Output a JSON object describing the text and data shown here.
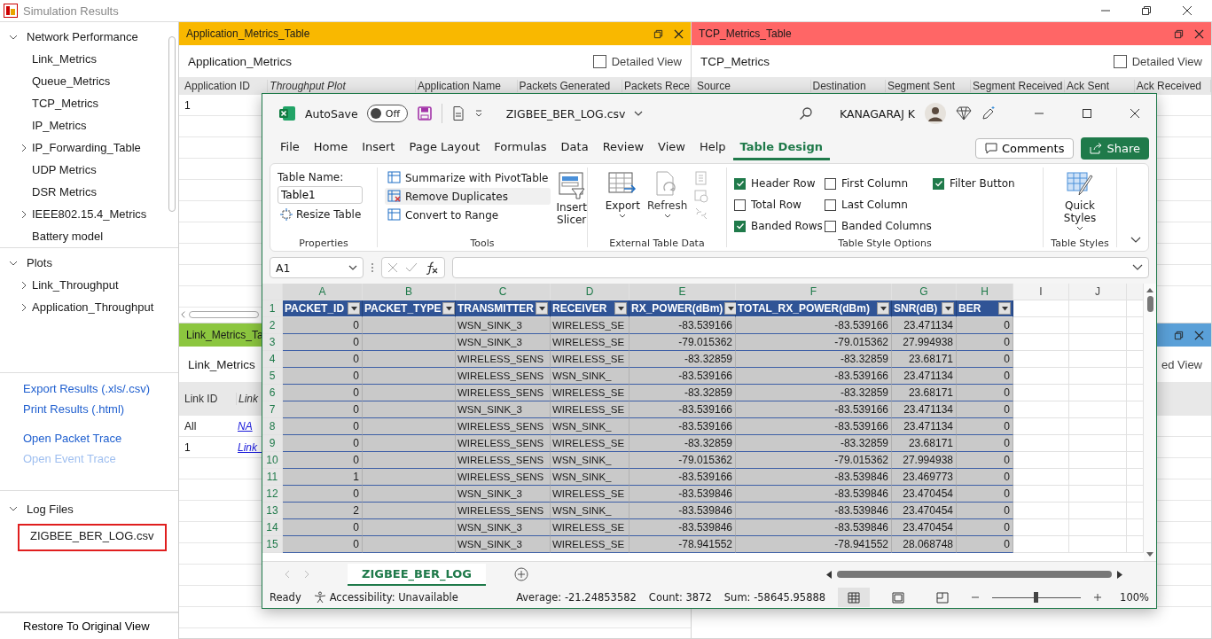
{
  "window": {
    "title": "Simulation Results"
  },
  "sidebar": {
    "tree": [
      {
        "label": "Network Performance",
        "expanded": true,
        "children": [
          {
            "label": "Link_Metrics",
            "kind": "leaf"
          },
          {
            "label": "Queue_Metrics",
            "kind": "leaf"
          },
          {
            "label": "TCP_Metrics",
            "kind": "leaf"
          },
          {
            "label": "IP_Metrics",
            "kind": "leaf"
          },
          {
            "label": "IP_Forwarding_Table",
            "kind": "branch",
            "expanded": false
          },
          {
            "label": "UDP Metrics",
            "kind": "leaf"
          },
          {
            "label": "DSR Metrics",
            "kind": "leaf"
          },
          {
            "label": "IEEE802.15.4_Metrics",
            "kind": "branch",
            "expanded": false
          },
          {
            "label": "Battery model",
            "kind": "leaf"
          }
        ]
      },
      {
        "label": "Plots",
        "expanded": true,
        "children": [
          {
            "label": "Link_Throughput",
            "kind": "branch",
            "expanded": false
          },
          {
            "label": "Application_Throughput",
            "kind": "branch",
            "expanded": false
          }
        ]
      }
    ],
    "links": [
      {
        "label": "Export Results (.xls/.csv)",
        "disabled": false
      },
      {
        "label": "Print Results (.html)",
        "disabled": false
      },
      {
        "label": "Open Packet Trace",
        "disabled": false
      },
      {
        "label": "Open Event Trace",
        "disabled": true
      }
    ],
    "log_files": {
      "label": "Log Files",
      "expanded": true,
      "files": [
        {
          "label": "ZIGBEE_BER_LOG.csv",
          "highlighted": true
        }
      ]
    },
    "restore_button": "Restore To Original View"
  },
  "panels": [
    {
      "title": "Application_Metrics_Table",
      "color": "#f9b800",
      "heading": "Application_Metrics",
      "detailed_view": {
        "label": "Detailed View",
        "checked": false
      },
      "columns": [
        {
          "label": "Application ID",
          "italic": false
        },
        {
          "label": "Throughput Plot",
          "italic": true
        },
        {
          "label": "Application Name",
          "italic": false
        },
        {
          "label": "Packets Generated",
          "italic": false
        },
        {
          "label": "Packets Rece",
          "italic": false
        }
      ],
      "rows": [
        [
          {
            "text": "1",
            "link": false
          }
        ]
      ]
    },
    {
      "title": "TCP_Metrics_Table",
      "color": "#ff6666",
      "heading": "TCP_Metrics",
      "detailed_view": {
        "label": "Detailed View",
        "checked": false
      },
      "columns": [
        {
          "label": "Source",
          "italic": false
        },
        {
          "label": "Destination",
          "italic": false
        },
        {
          "label": "Segment Sent",
          "italic": false
        },
        {
          "label": "Segment Received",
          "italic": false
        },
        {
          "label": "Ack Sent",
          "italic": false
        },
        {
          "label": "Ack Received",
          "italic": false
        }
      ]
    },
    {
      "title": "Link_Metrics_Ta",
      "color": "#8cc63f",
      "heading": "Link_Metrics",
      "columns": [
        {
          "label": "Link ID",
          "italic": false
        },
        {
          "label": "Link",
          "italic": true
        }
      ],
      "rows": [
        [
          {
            "text": "All",
            "link": false
          },
          {
            "text": "NA",
            "link": true
          }
        ],
        [
          {
            "text": "1",
            "link": false
          },
          {
            "text": "Link_",
            "link": true
          }
        ]
      ]
    },
    {
      "color": "#5aa0d8",
      "detailed_view": {
        "label": "ed View"
      }
    }
  ],
  "excel": {
    "autosave": {
      "label": "AutoSave",
      "on": false,
      "state_label": "Off"
    },
    "file_name": "ZIGBEE_BER_LOG.csv",
    "user": "KANAGARAJ K",
    "tabs": [
      {
        "label": "File",
        "selected": false
      },
      {
        "label": "Home",
        "selected": false
      },
      {
        "label": "Insert",
        "selected": false
      },
      {
        "label": "Page Layout",
        "selected": false
      },
      {
        "label": "Formulas",
        "selected": false
      },
      {
        "label": "Data",
        "selected": false
      },
      {
        "label": "Review",
        "selected": false
      },
      {
        "label": "View",
        "selected": false
      },
      {
        "label": "Help",
        "selected": false
      },
      {
        "label": "Table Design",
        "selected": true
      }
    ],
    "comments": "Comments",
    "share": "Share",
    "ribbon": {
      "properties": {
        "name_label": "Table Name:",
        "name_value": "Table1",
        "resize": "Resize Table",
        "group": "Properties"
      },
      "tools": {
        "items": [
          "Summarize with PivotTable",
          "Remove Duplicates",
          "Convert to Range"
        ],
        "slicer": "Insert Slicer",
        "group": "Tools"
      },
      "external": {
        "export": "Export",
        "refresh": "Refresh",
        "group": "External Table Data"
      },
      "style_options": {
        "options": [
          {
            "label": "Header Row",
            "checked": true
          },
          {
            "label": "Total Row",
            "checked": false
          },
          {
            "label": "Banded Rows",
            "checked": true
          },
          {
            "label": "First Column",
            "checked": false
          },
          {
            "label": "Last Column",
            "checked": false
          },
          {
            "label": "Banded Columns",
            "checked": false
          },
          {
            "label": "Filter Button",
            "checked": true
          }
        ],
        "group": "Table Style Options"
      },
      "styles": {
        "label": "Quick Styles",
        "group": "Table Styles"
      }
    },
    "name_box": "A1",
    "sheet": {
      "column_letters": [
        "A",
        "B",
        "C",
        "D",
        "E",
        "F",
        "G",
        "H",
        "I",
        "J"
      ],
      "header_row_number": "1",
      "headers": [
        "PACKET_ID",
        "PACKET_TYPE",
        "TRANSMITTER",
        "RECEIVER",
        "RX_POWER(dBm)",
        "TOTAL_RX_POWER(dBm)",
        "SNR(dB)",
        "BER"
      ],
      "rows": [
        {
          "n": "2",
          "cells": [
            "0",
            "WSN_SINK_3",
            "WIRELESS_SE",
            "-83.539166",
            "-83.539166",
            "23.471134",
            "0"
          ]
        },
        {
          "n": "3",
          "cells": [
            "0",
            "WSN_SINK_3",
            "WIRELESS_SE",
            "-79.015362",
            "-79.015362",
            "27.994938",
            "0"
          ]
        },
        {
          "n": "4",
          "cells": [
            "0",
            "WIRELESS_SENS",
            "WIRELESS_SE",
            "-83.32859",
            "-83.32859",
            "23.68171",
            "0"
          ]
        },
        {
          "n": "5",
          "cells": [
            "0",
            "WIRELESS_SENS",
            "WSN_SINK_",
            "-83.539166",
            "-83.539166",
            "23.471134",
            "0"
          ]
        },
        {
          "n": "6",
          "cells": [
            "0",
            "WIRELESS_SENS",
            "WIRELESS_SE",
            "-83.32859",
            "-83.32859",
            "23.68171",
            "0"
          ]
        },
        {
          "n": "7",
          "cells": [
            "0",
            "WSN_SINK_3",
            "WIRELESS_SE",
            "-83.539166",
            "-83.539166",
            "23.471134",
            "0"
          ]
        },
        {
          "n": "8",
          "cells": [
            "0",
            "WIRELESS_SENS",
            "WSN_SINK_",
            "-83.539166",
            "-83.539166",
            "23.471134",
            "0"
          ]
        },
        {
          "n": "9",
          "cells": [
            "0",
            "WIRELESS_SENS",
            "WIRELESS_SE",
            "-83.32859",
            "-83.32859",
            "23.68171",
            "0"
          ]
        },
        {
          "n": "10",
          "cells": [
            "0",
            "WIRELESS_SENS",
            "WSN_SINK_",
            "-79.015362",
            "-79.015362",
            "27.994938",
            "0"
          ]
        },
        {
          "n": "11",
          "cells": [
            "1",
            "WIRELESS_SENS",
            "WSN_SINK_",
            "-83.539166",
            "-83.539846",
            "23.469773",
            "0"
          ]
        },
        {
          "n": "12",
          "cells": [
            "0",
            "WSN_SINK_3",
            "WIRELESS_SE",
            "-83.539846",
            "-83.539846",
            "23.470454",
            "0"
          ]
        },
        {
          "n": "13",
          "cells": [
            "2",
            "WIRELESS_SENS",
            "WSN_SINK_",
            "-83.539846",
            "-83.539846",
            "23.470454",
            "0"
          ]
        },
        {
          "n": "14",
          "cells": [
            "0",
            "WSN_SINK_3",
            "WIRELESS_SE",
            "-83.539846",
            "-83.539846",
            "23.470454",
            "0"
          ]
        },
        {
          "n": "15",
          "cells": [
            "0",
            "WSN_SINK_3",
            "WIRELESS_SE",
            "-78.941552",
            "-78.941552",
            "28.068748",
            "0"
          ]
        }
      ]
    },
    "sheet_tab": "ZIGBEE_BER_LOG",
    "status": {
      "ready": "Ready",
      "accessibility": "Accessibility: Unavailable",
      "average": "Average: -21.24853582",
      "count": "Count: 3872",
      "sum": "Sum: -58645.95888",
      "zoom": {
        "level": 0.5,
        "label": "100%"
      }
    }
  }
}
